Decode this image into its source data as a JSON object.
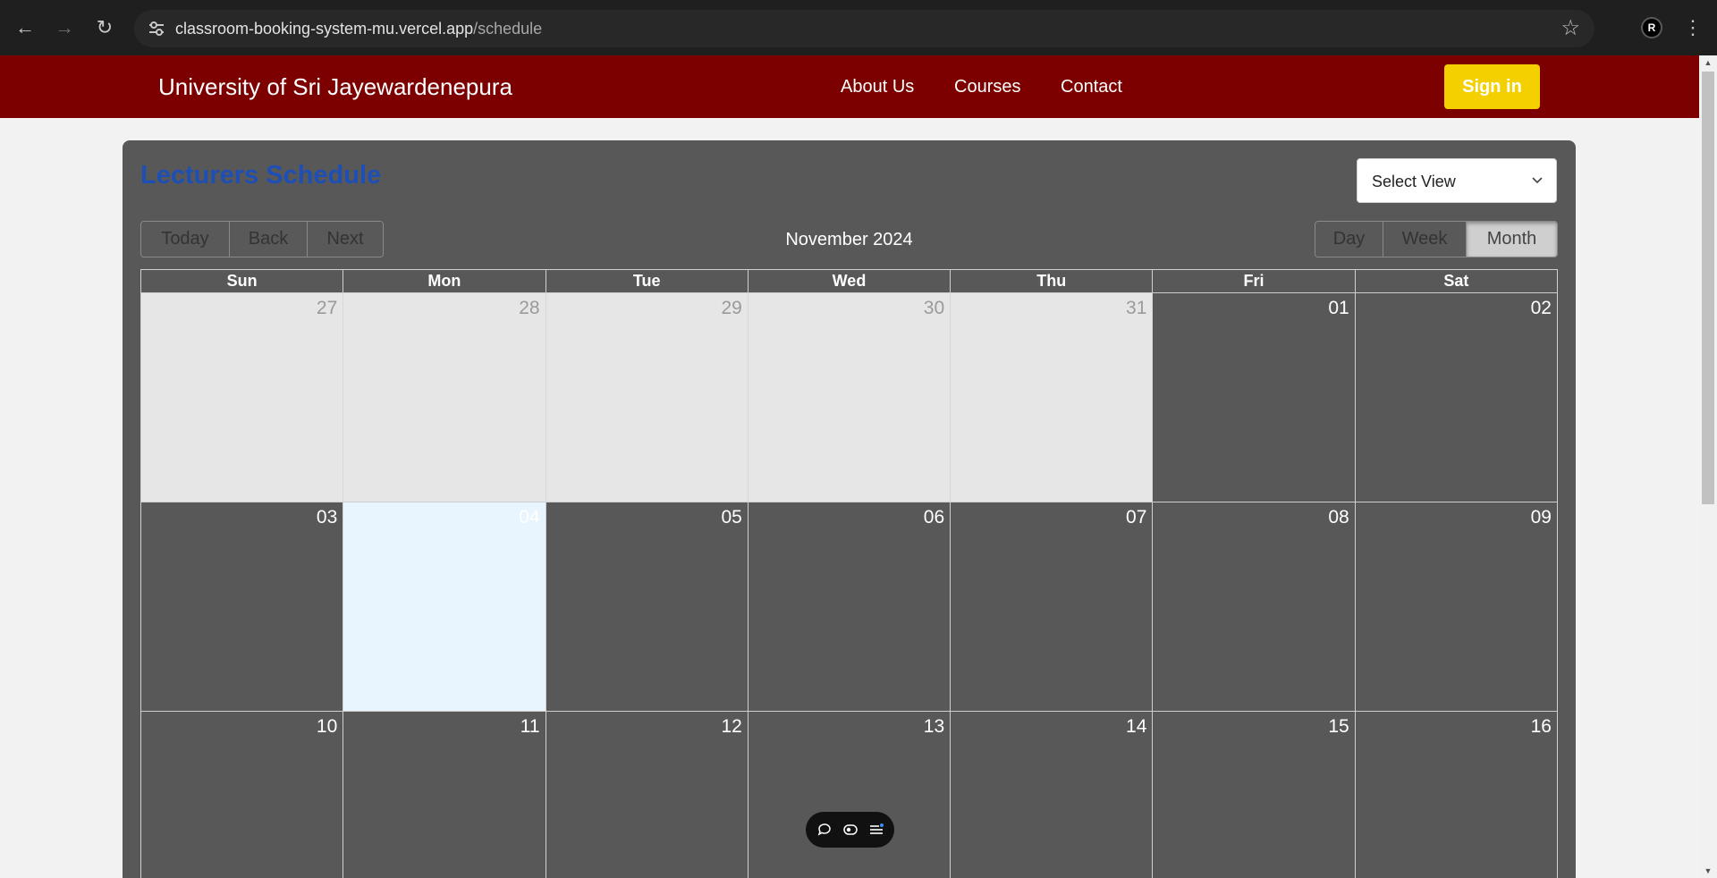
{
  "browser": {
    "url_host": "classroom-booking-system-mu.vercel.app",
    "url_path": "/schedule",
    "profile_initial": "R"
  },
  "header": {
    "brand": "University of Sri Jayewardenepura",
    "nav": [
      "About Us",
      "Courses",
      "Contact"
    ],
    "signin_label": "Sign in",
    "colors": {
      "bar": "#7d0000",
      "signin": "#f5d000"
    }
  },
  "schedule": {
    "title": "Lecturers Schedule",
    "select_view_label": "Select View",
    "nav_buttons": [
      "Today",
      "Back",
      "Next"
    ],
    "month_label": "November 2024",
    "view_buttons": [
      "Day",
      "Week",
      "Month"
    ],
    "active_view": "Month",
    "weekdays": [
      "Sun",
      "Mon",
      "Tue",
      "Wed",
      "Thu",
      "Fri",
      "Sat"
    ],
    "weeks": [
      [
        "27",
        "28",
        "29",
        "30",
        "31",
        "01",
        "02"
      ],
      [
        "03",
        "04",
        "05",
        "06",
        "07",
        "08",
        "09"
      ],
      [
        "10",
        "11",
        "12",
        "13",
        "14",
        "15",
        "16"
      ]
    ],
    "today": "04",
    "title_color": "#1e4fb5"
  },
  "toolbar": {
    "icons": [
      "comment-icon",
      "eye-toggle-icon",
      "menu-icon"
    ]
  }
}
